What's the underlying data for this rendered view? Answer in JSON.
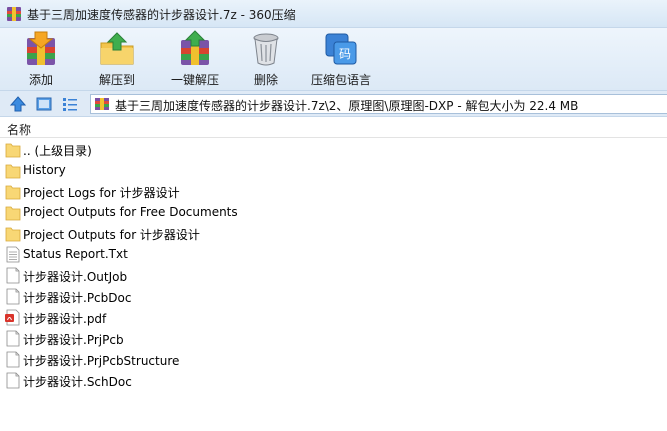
{
  "window": {
    "title": "基于三周加速度传感器的计步器设计.7z - 360压缩"
  },
  "toolbar": {
    "add_label": "添加",
    "extract_to_label": "解压到",
    "one_click_extract_label": "一键解压",
    "delete_label": "删除",
    "language_label": "压缩包语言"
  },
  "address": {
    "path": "基于三周加速度传感器的计步器设计.7z\\2、原理图\\原理图-DXP - 解包大小为 22.4 MB"
  },
  "columns": {
    "name": "名称"
  },
  "files": [
    {
      "name": ".. (上级目录)",
      "icon": "folder-icon"
    },
    {
      "name": "History",
      "icon": "folder-icon"
    },
    {
      "name": "Project Logs for 计步器设计",
      "icon": "folder-icon"
    },
    {
      "name": "Project Outputs for Free Documents",
      "icon": "folder-icon"
    },
    {
      "name": "Project Outputs for 计步器设计",
      "icon": "folder-icon"
    },
    {
      "name": "Status Report.Txt",
      "icon": "text-file-icon"
    },
    {
      "name": "计步器设计.OutJob",
      "icon": "file-icon"
    },
    {
      "name": "计步器设计.PcbDoc",
      "icon": "file-icon"
    },
    {
      "name": "计步器设计.pdf",
      "icon": "pdf-file-icon"
    },
    {
      "name": "计步器设计.PrjPcb",
      "icon": "file-icon"
    },
    {
      "name": "计步器设计.PrjPcbStructure",
      "icon": "file-icon"
    },
    {
      "name": "计步器设计.SchDoc",
      "icon": "file-icon"
    }
  ]
}
